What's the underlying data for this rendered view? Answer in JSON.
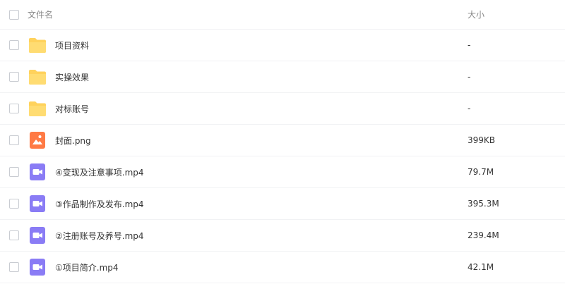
{
  "header": {
    "name_label": "文件名",
    "size_label": "大小"
  },
  "files": [
    {
      "name": "项目资料",
      "size": "-",
      "icon": "folder-icon"
    },
    {
      "name": "实操效果",
      "size": "-",
      "icon": "folder-icon"
    },
    {
      "name": "对标账号",
      "size": "-",
      "icon": "folder-icon"
    },
    {
      "name": "封面.png",
      "size": "399KB",
      "icon": "image-file-icon"
    },
    {
      "name": "④变现及注意事项.mp4",
      "size": "79.7M",
      "icon": "video-file-icon"
    },
    {
      "name": "③作品制作及发布.mp4",
      "size": "395.3M",
      "icon": "video-file-icon"
    },
    {
      "name": "②注册账号及养号.mp4",
      "size": "239.4M",
      "icon": "video-file-icon"
    },
    {
      "name": "①项目简介.mp4",
      "size": "42.1M",
      "icon": "video-file-icon"
    }
  ],
  "colors": {
    "folder": "#ffd25c",
    "image": "#ff7a45",
    "video": "#8a7cf5",
    "border": "#f1f2f4"
  }
}
